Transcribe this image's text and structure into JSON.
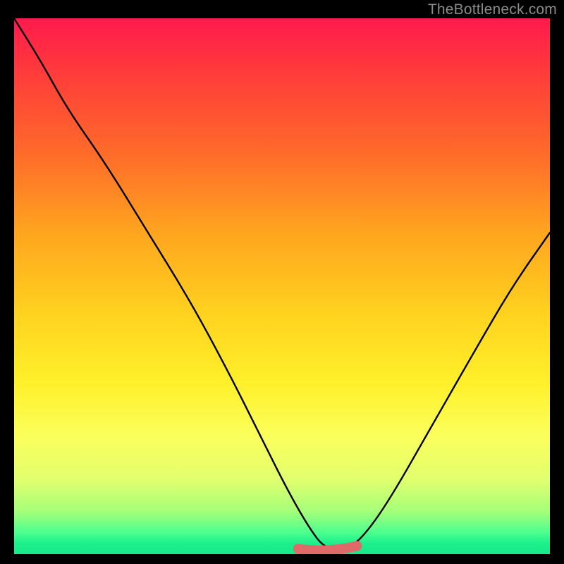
{
  "watermark": "TheBottleneck.com",
  "chart_data": {
    "type": "line",
    "title": "",
    "xlabel": "",
    "ylabel": "",
    "xlim": [
      0,
      100
    ],
    "ylim": [
      0,
      100
    ],
    "series": [
      {
        "name": "bottleneck-curve",
        "x": [
          0,
          5,
          10,
          17,
          25,
          33,
          40,
          46,
          51,
          55,
          58,
          62,
          65,
          70,
          78,
          86,
          93,
          100
        ],
        "values": [
          100,
          92,
          83,
          73,
          60,
          47,
          34,
          22,
          12,
          5,
          1,
          1,
          3,
          10,
          24,
          38,
          50,
          60
        ]
      }
    ],
    "highlight": {
      "name": "flat-zone",
      "x_range": [
        53,
        64
      ],
      "y": 1
    }
  },
  "colors": {
    "curve": "#000000",
    "highlight": "#e06a6a",
    "gradient_top": "#ff1a4d",
    "gradient_bottom": "#17e88a",
    "background": "#000000",
    "watermark": "#8a8a8a"
  }
}
